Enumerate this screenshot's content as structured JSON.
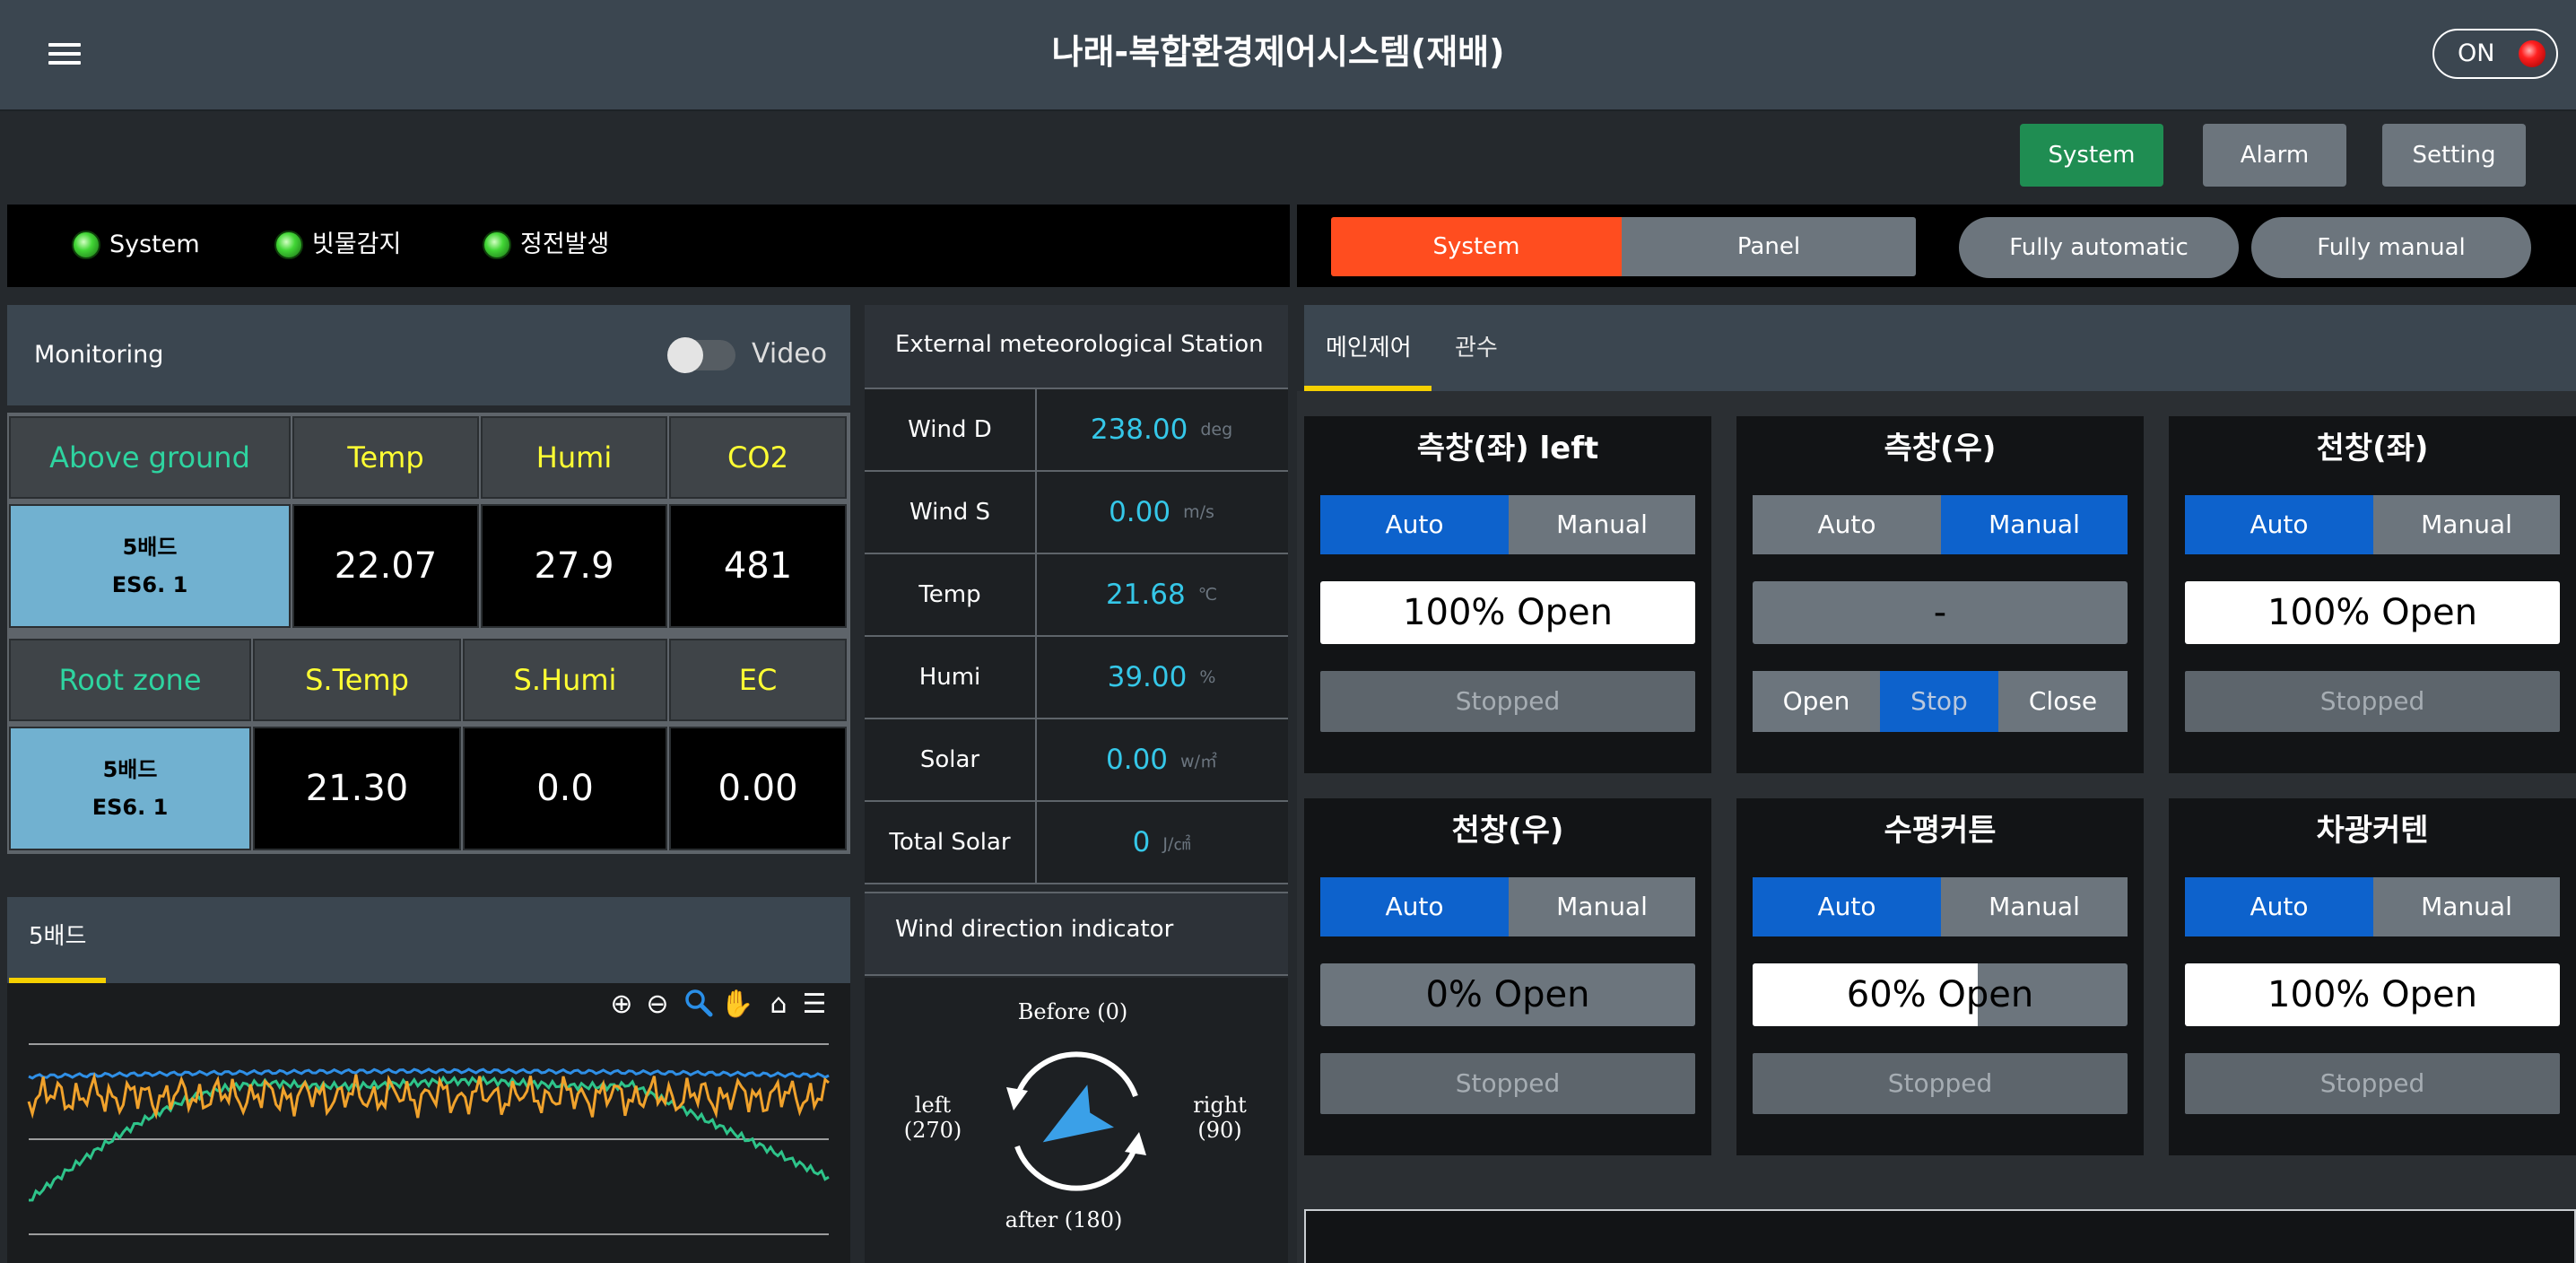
{
  "header": {
    "title": "나래-복합환경제어시스템(재배)",
    "power_label": "ON"
  },
  "nav": {
    "system": "System",
    "alarm": "Alarm",
    "setting": "Setting"
  },
  "status": [
    {
      "label": "System",
      "led": "green"
    },
    {
      "label": "빗물감지",
      "led": "green"
    },
    {
      "label": "정전발생",
      "led": "green"
    }
  ],
  "mode": {
    "system": "System",
    "panel": "Panel",
    "fully_automatic": "Fully automatic",
    "fully_manual": "Fully manual",
    "active_color": "#ff4d1f"
  },
  "monitoring": {
    "title": "Monitoring",
    "video_label": "Video",
    "video_on": false,
    "above": {
      "header": "Above ground",
      "columns": [
        "Temp",
        "Humi",
        "CO2"
      ],
      "bed_name": "5배드",
      "bed_code": "ES6. 1",
      "values": [
        "22.07",
        "27.9",
        "481"
      ]
    },
    "root": {
      "header": "Root zone",
      "columns": [
        "S.Temp",
        "S.Humi",
        "EC"
      ],
      "bed_name": "5배드",
      "bed_code": "ES6. 1",
      "values": [
        "21.30",
        "0.0",
        "0.00"
      ]
    }
  },
  "bed_chart": {
    "tab": "5배드",
    "toolbar": [
      "zoom-in-icon",
      "zoom-out-icon",
      "selection-zoom-icon",
      "pan-icon",
      "home-icon",
      "menu-icon"
    ],
    "series_colors": [
      "#2f8fe6",
      "#f0a22c",
      "#2ec48a"
    ]
  },
  "external_station": {
    "title": "External meteorological Station",
    "rows": [
      {
        "label": "Wind D",
        "value": "238.00",
        "unit": "deg"
      },
      {
        "label": "Wind S",
        "value": "0.00",
        "unit": "m/s"
      },
      {
        "label": "Temp",
        "value": "21.68",
        "unit": "℃"
      },
      {
        "label": "Humi",
        "value": "39.00",
        "unit": "%"
      },
      {
        "label": "Solar",
        "value": "0.00",
        "unit": "w/㎡"
      },
      {
        "label": "Total Solar",
        "value": "0",
        "unit": "J/㎠"
      }
    ]
  },
  "wind_direction": {
    "title": "Wind direction indicator",
    "before": "Before (0)",
    "left": "left",
    "left_deg": "(270)",
    "right": "right",
    "right_deg": "(90)",
    "after": "after (180)"
  },
  "control_tabs": [
    "메인제어",
    "관수"
  ],
  "cards": [
    {
      "title": "측창(좌) left",
      "auto": "Auto",
      "manual": "Manual",
      "mode": "auto",
      "display": "100% Open",
      "status": "Stopped"
    },
    {
      "title": "측창(우)",
      "auto": "Auto",
      "manual": "Manual",
      "mode": "manual",
      "display": "-",
      "open": "Open",
      "stop": "Stop",
      "close": "Close"
    },
    {
      "title": "천창(좌)",
      "auto": "Auto",
      "manual": "Manual",
      "mode": "auto",
      "display": "100% Open",
      "status": "Stopped"
    },
    {
      "title": "천창(우)",
      "auto": "Auto",
      "manual": "Manual",
      "mode": "auto",
      "display": "0% Open",
      "status": "Stopped"
    },
    {
      "title": "수평커튼",
      "auto": "Auto",
      "manual": "Manual",
      "mode": "auto",
      "display": "60% Open",
      "open_fraction": 0.6,
      "status": "Stopped"
    },
    {
      "title": "차광커텐",
      "auto": "Auto",
      "manual": "Manual",
      "mode": "auto",
      "display": "100% Open",
      "status": "Stopped"
    }
  ]
}
